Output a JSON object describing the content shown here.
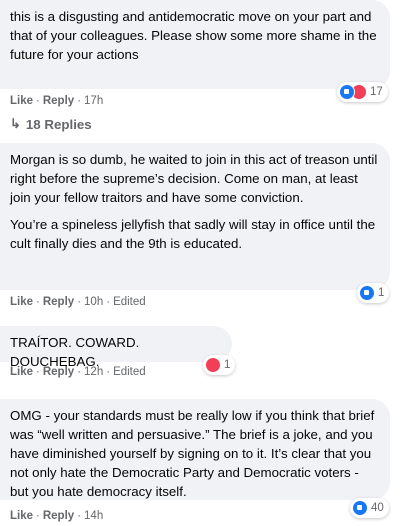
{
  "comments": [
    {
      "paragraphs": [
        "this is a disgusting and antidemocratic move on your part and that of your colleagues. Please show some more shame in the future for your actions"
      ],
      "like": "Like",
      "reply": "Reply",
      "time": "17h",
      "edited": "",
      "reactions": [
        "like",
        "love"
      ],
      "reaction_count": "17"
    },
    {
      "paragraphs": [
        "Morgan is so dumb, he waited to join in this act of treason until right before the supreme’s decision. Come on man, at least join your fellow traitors and have some conviction.",
        "You’re a spineless jellyfish that sadly will stay in office until the cult finally dies and the 9th is educated."
      ],
      "like": "Like",
      "reply": "Reply",
      "time": "10h",
      "edited": "Edited",
      "reactions": [
        "like"
      ],
      "reaction_count": "1"
    },
    {
      "paragraphs": [
        "TRAÍTOR. COWARD. DOUCHEBAG."
      ],
      "like": "Like",
      "reply": "Reply",
      "time": "12h",
      "edited": "Edited",
      "reactions": [
        "love"
      ],
      "reaction_count": "1"
    },
    {
      "paragraphs": [
        "OMG - your standards must be really low if you think that brief was “well written and persuasive.” The brief is a joke, and you have diminished yourself by signing on to it. It’s clear that you not only hate the Democratic Party and Democratic voters - but you hate democracy itself."
      ],
      "like": "Like",
      "reply": "Reply",
      "time": "14h",
      "edited": "",
      "reactions": [
        "like"
      ],
      "reaction_count": "40"
    }
  ],
  "replies_link": "18 Replies",
  "colors": {
    "bubble_bg": "#f0f2f5",
    "meta_text": "#65676b",
    "like_blue": "#1877f2",
    "love_red": "#f33e58"
  }
}
